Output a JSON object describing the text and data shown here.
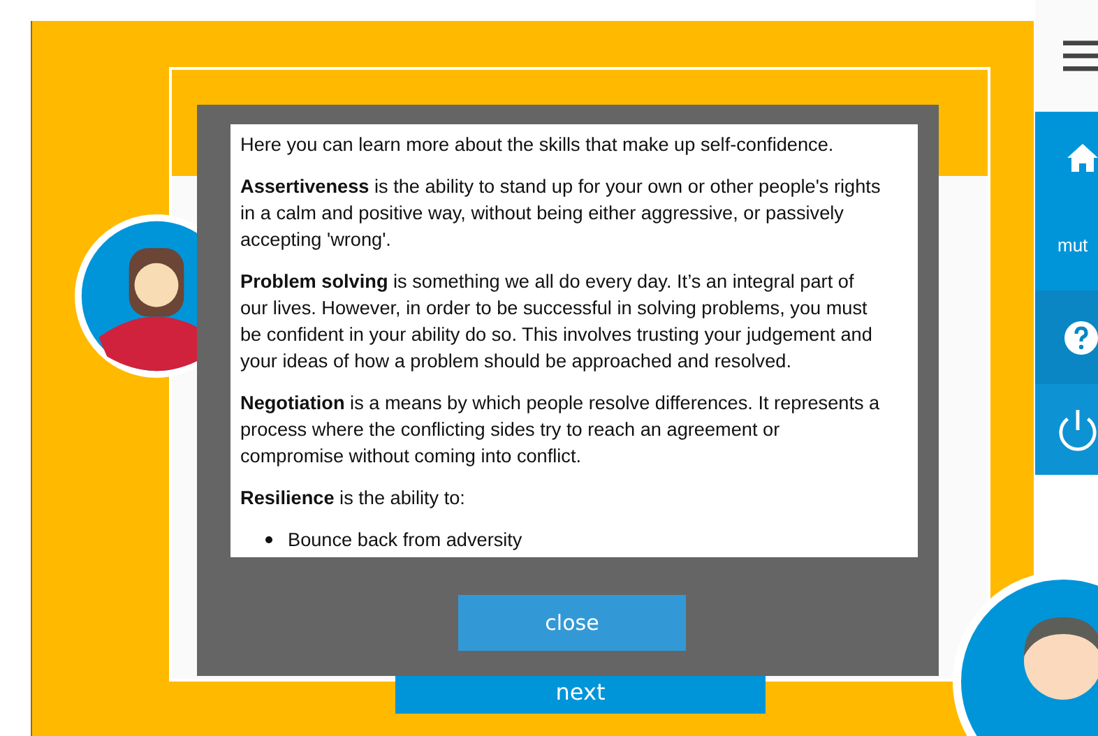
{
  "sidebar": {
    "mute_label": "mut"
  },
  "next_button": {
    "label": "next"
  },
  "dialog": {
    "paragraphs": [
      "Here you can learn more about the skills that make up self-confidence.",
      "**Assertiveness** is the ability to stand up for your own or other people's rights in a calm and positive way, without being either aggressive, or passively accepting 'wrong'.",
      "**Problem solving** is something we all do every day. It’s an integral part of our lives. However, in order to be successful in solving problems, you must be confident in your ability do so. This involves trusting your judgement and your ideas of how a problem should be approached and resolved.",
      "**Negotiation** is a means by which people resolve differences. It represents a process where the conflicting sides try to reach an agreement or compromise without coming into conflict.",
      "**Resilience** is the ability to:"
    ],
    "list": [
      "Bounce back from adversity"
    ],
    "close_button": "close"
  }
}
